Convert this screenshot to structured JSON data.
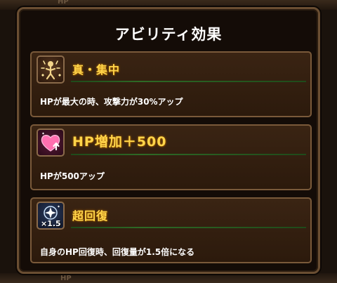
{
  "dialog": {
    "title": "アビリティ効果",
    "abilities": [
      {
        "name": "真・集中",
        "description": "HPが最大の時、攻撃力が30%アップ",
        "icon": "figure-focus-icon"
      },
      {
        "name": "HP増加＋500",
        "description": "HPが500アップ",
        "icon": "heart-up-icon"
      },
      {
        "name": "超回復",
        "description": "自身のHP回復時、回復量が1.5倍になる",
        "icon": "sparkle-recover-icon",
        "icon_label": "×1.5"
      }
    ]
  },
  "colors": {
    "ability_name": "#ffd54a",
    "card_border": "#7a5a3a",
    "frame": "#6a4e32"
  }
}
